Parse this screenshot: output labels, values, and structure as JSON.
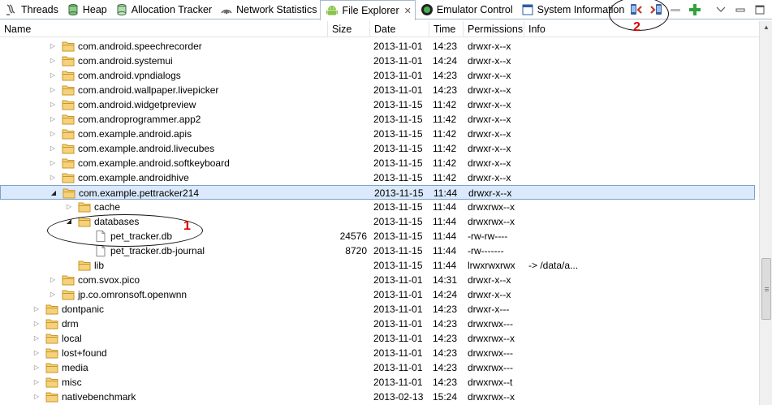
{
  "tabs": [
    {
      "label": "Threads",
      "icon": "threads-icon"
    },
    {
      "label": "Heap",
      "icon": "heap-icon"
    },
    {
      "label": "Allocation Tracker",
      "icon": "allocation-tracker-icon"
    },
    {
      "label": "Network Statistics",
      "icon": "network-statistics-icon"
    },
    {
      "label": "File Explorer",
      "icon": "android-icon",
      "active": true
    },
    {
      "label": "Emulator Control",
      "icon": "emulator-control-icon"
    },
    {
      "label": "System Information",
      "icon": "system-information-icon"
    }
  ],
  "toolbar": {
    "pull_file": "pull-file-from-device-icon",
    "push_file": "push-file-onto-device-icon",
    "delete": "delete-icon",
    "new_folder": "new-folder-plus-icon",
    "view_menu": "view-menu-icon",
    "minimize": "minimize-icon",
    "maximize": "maximize-icon"
  },
  "columns": {
    "name": "Name",
    "size": "Size",
    "date": "Date",
    "time": "Time",
    "permissions": "Permissions",
    "info": "Info"
  },
  "rows": [
    {
      "name": "com.android.speechrecorder",
      "size": "",
      "date": "2013-11-01",
      "time": "14:23",
      "perm": "drwxr-x--x",
      "info": "",
      "depth": 2,
      "type": "folder",
      "expanded": false
    },
    {
      "name": "com.android.systemui",
      "size": "",
      "date": "2013-11-01",
      "time": "14:24",
      "perm": "drwxr-x--x",
      "info": "",
      "depth": 2,
      "type": "folder",
      "expanded": false
    },
    {
      "name": "com.android.vpndialogs",
      "size": "",
      "date": "2013-11-01",
      "time": "14:23",
      "perm": "drwxr-x--x",
      "info": "",
      "depth": 2,
      "type": "folder",
      "expanded": false
    },
    {
      "name": "com.android.wallpaper.livepicker",
      "size": "",
      "date": "2013-11-01",
      "time": "14:23",
      "perm": "drwxr-x--x",
      "info": "",
      "depth": 2,
      "type": "folder",
      "expanded": false
    },
    {
      "name": "com.android.widgetpreview",
      "size": "",
      "date": "2013-11-15",
      "time": "11:42",
      "perm": "drwxr-x--x",
      "info": "",
      "depth": 2,
      "type": "folder",
      "expanded": false
    },
    {
      "name": "com.androprogrammer.app2",
      "size": "",
      "date": "2013-11-15",
      "time": "11:42",
      "perm": "drwxr-x--x",
      "info": "",
      "depth": 2,
      "type": "folder",
      "expanded": false
    },
    {
      "name": "com.example.android.apis",
      "size": "",
      "date": "2013-11-15",
      "time": "11:42",
      "perm": "drwxr-x--x",
      "info": "",
      "depth": 2,
      "type": "folder",
      "expanded": false
    },
    {
      "name": "com.example.android.livecubes",
      "size": "",
      "date": "2013-11-15",
      "time": "11:42",
      "perm": "drwxr-x--x",
      "info": "",
      "depth": 2,
      "type": "folder",
      "expanded": false
    },
    {
      "name": "com.example.android.softkeyboard",
      "size": "",
      "date": "2013-11-15",
      "time": "11:42",
      "perm": "drwxr-x--x",
      "info": "",
      "depth": 2,
      "type": "folder",
      "expanded": false
    },
    {
      "name": "com.example.androidhive",
      "size": "",
      "date": "2013-11-15",
      "time": "11:42",
      "perm": "drwxr-x--x",
      "info": "",
      "depth": 2,
      "type": "folder",
      "expanded": false
    },
    {
      "name": "com.example.pettracker214",
      "size": "",
      "date": "2013-11-15",
      "time": "11:44",
      "perm": "drwxr-x--x",
      "info": "",
      "depth": 2,
      "type": "folder",
      "expanded": true,
      "selected": true
    },
    {
      "name": "cache",
      "size": "",
      "date": "2013-11-15",
      "time": "11:44",
      "perm": "drwxrwx--x",
      "info": "",
      "depth": 3,
      "type": "folder",
      "expanded": false
    },
    {
      "name": "databases",
      "size": "",
      "date": "2013-11-15",
      "time": "11:44",
      "perm": "drwxrwx--x",
      "info": "",
      "depth": 3,
      "type": "folder",
      "expanded": true
    },
    {
      "name": "pet_tracker.db",
      "size": "24576",
      "date": "2013-11-15",
      "time": "11:44",
      "perm": "-rw-rw----",
      "info": "",
      "depth": 4,
      "type": "file"
    },
    {
      "name": "pet_tracker.db-journal",
      "size": "8720",
      "date": "2013-11-15",
      "time": "11:44",
      "perm": "-rw-------",
      "info": "",
      "depth": 4,
      "type": "file"
    },
    {
      "name": "lib",
      "size": "",
      "date": "2013-11-15",
      "time": "11:44",
      "perm": "lrwxrwxrwx",
      "info": "-> /data/a...",
      "depth": 3,
      "type": "folder",
      "noarrow": true
    },
    {
      "name": "com.svox.pico",
      "size": "",
      "date": "2013-11-01",
      "time": "14:31",
      "perm": "drwxr-x--x",
      "info": "",
      "depth": 2,
      "type": "folder",
      "expanded": false
    },
    {
      "name": "jp.co.omronsoft.openwnn",
      "size": "",
      "date": "2013-11-01",
      "time": "14:24",
      "perm": "drwxr-x--x",
      "info": "",
      "depth": 2,
      "type": "folder",
      "expanded": false
    },
    {
      "name": "dontpanic",
      "size": "",
      "date": "2013-11-01",
      "time": "14:23",
      "perm": "drwxr-x---",
      "info": "",
      "depth": 1,
      "type": "folder",
      "expanded": false
    },
    {
      "name": "drm",
      "size": "",
      "date": "2013-11-01",
      "time": "14:23",
      "perm": "drwxrwx---",
      "info": "",
      "depth": 1,
      "type": "folder",
      "expanded": false
    },
    {
      "name": "local",
      "size": "",
      "date": "2013-11-01",
      "time": "14:23",
      "perm": "drwxrwx--x",
      "info": "",
      "depth": 1,
      "type": "folder",
      "expanded": false
    },
    {
      "name": "lost+found",
      "size": "",
      "date": "2013-11-01",
      "time": "14:23",
      "perm": "drwxrwx---",
      "info": "",
      "depth": 1,
      "type": "folder",
      "expanded": false
    },
    {
      "name": "media",
      "size": "",
      "date": "2013-11-01",
      "time": "14:23",
      "perm": "drwxrwx---",
      "info": "",
      "depth": 1,
      "type": "folder",
      "expanded": false
    },
    {
      "name": "misc",
      "size": "",
      "date": "2013-11-01",
      "time": "14:23",
      "perm": "drwxrwx--t",
      "info": "",
      "depth": 1,
      "type": "folder",
      "expanded": false
    },
    {
      "name": "nativebenchmark",
      "size": "",
      "date": "2013-02-13",
      "time": "15:24",
      "perm": "drwxrwx--x",
      "info": "",
      "depth": 1,
      "type": "folder",
      "expanded": false
    }
  ],
  "annotations": {
    "one": "1",
    "two": "2"
  },
  "colors": {
    "folder": "#e8b84a",
    "selection": "#dae9fb",
    "selection_border": "#7da2ce",
    "annotation": "#d40000"
  }
}
